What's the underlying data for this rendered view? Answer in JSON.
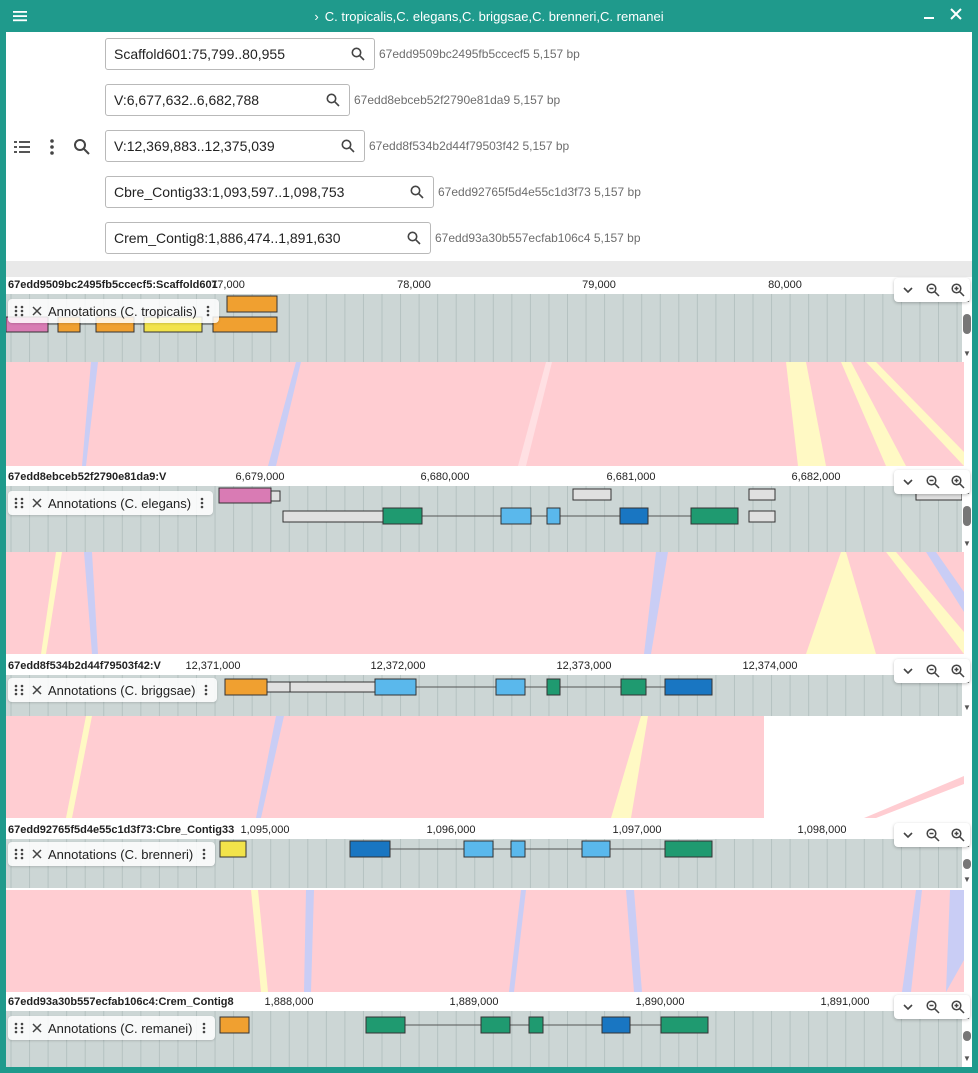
{
  "window": {
    "title": "C. tropicalis,C. elegans,C. briggsae,C. brenneri,C. remanei"
  },
  "header": {
    "locations": [
      {
        "loc": "Scaffold601:75,799..80,955",
        "meta": "67edd9509bc2495fb5ccecf5 5,157 bp"
      },
      {
        "loc": "V:6,677,632..6,682,788",
        "meta": "67edd8ebceb52f2790e81da9 5,157 bp"
      },
      {
        "loc": "V:12,369,883..12,375,039",
        "meta": "67edd8f534b2d44f79503f42 5,157 bp"
      },
      {
        "loc": "Cbre_Contig33:1,093,597..1,098,753",
        "meta": "67edd92765f5d4e55c1d3f73 5,157 bp"
      },
      {
        "loc": "Crem_Contig8:1,886,474..1,891,630",
        "meta": "67edd93a30b557ecfab106c4 5,157 bp"
      }
    ]
  },
  "views": [
    {
      "assembly": "67edd9509bc2495fb5ccecf5:Scaffold601",
      "ticks": [
        "77,000",
        "78,000",
        "79,000",
        "80,000"
      ],
      "track_label": "Annotations (C. tropicalis)"
    },
    {
      "assembly": "67edd8ebceb52f2790e81da9:V",
      "ticks": [
        "6,679,000",
        "6,680,000",
        "6,681,000",
        "6,682,000"
      ],
      "track_label": "Annotations (C. elegans)"
    },
    {
      "assembly": "67edd8f534b2d44f79503f42:V",
      "ticks": [
        "12,371,000",
        "12,372,000",
        "12,373,000",
        "12,374,000"
      ],
      "track_label": "Annotations (C. briggsae)"
    },
    {
      "assembly": "67edd92765f5d4e55c1d3f73:Cbre_Contig33",
      "ticks": [
        "1,095,000",
        "1,096,000",
        "1,097,000",
        "1,098,000"
      ],
      "track_label": "Annotations (C. brenneri)"
    },
    {
      "assembly": "67edd93a30b557ecfab106c4:Crem_Contig8",
      "ticks": [
        "1,888,000",
        "1,889,000",
        "1,890,000",
        "1,891,000"
      ],
      "track_label": "Annotations (C. remanei)"
    }
  ],
  "icons": {
    "menu": "hamburger-menu-icon",
    "chevron": "chevron-right-icon",
    "minimize": "minimize-icon",
    "close": "close-icon",
    "search": "search-icon",
    "tracks": "track-selector-icon",
    "more": "more-vert-icon",
    "zoom_in": "zoom-in-icon",
    "zoom_out": "zoom-out-icon",
    "drag": "drag-handle-icon"
  },
  "colors": {
    "header_bar": "#1f9a8c",
    "track_bg": "#ccd6d5",
    "synteny_pink": "#ffcdd2",
    "synteny_blue": "#c9cdf5",
    "synteny_yellow": "#fff9c4",
    "gene_orange": "#f0a030",
    "gene_pink": "#d97bb4",
    "gene_yellow": "#f2e34a",
    "gene_green": "#1f9a70",
    "gene_lightblue": "#5ab8ec",
    "gene_darkblue": "#1976c2",
    "gene_grey": "#e0e0e0"
  }
}
